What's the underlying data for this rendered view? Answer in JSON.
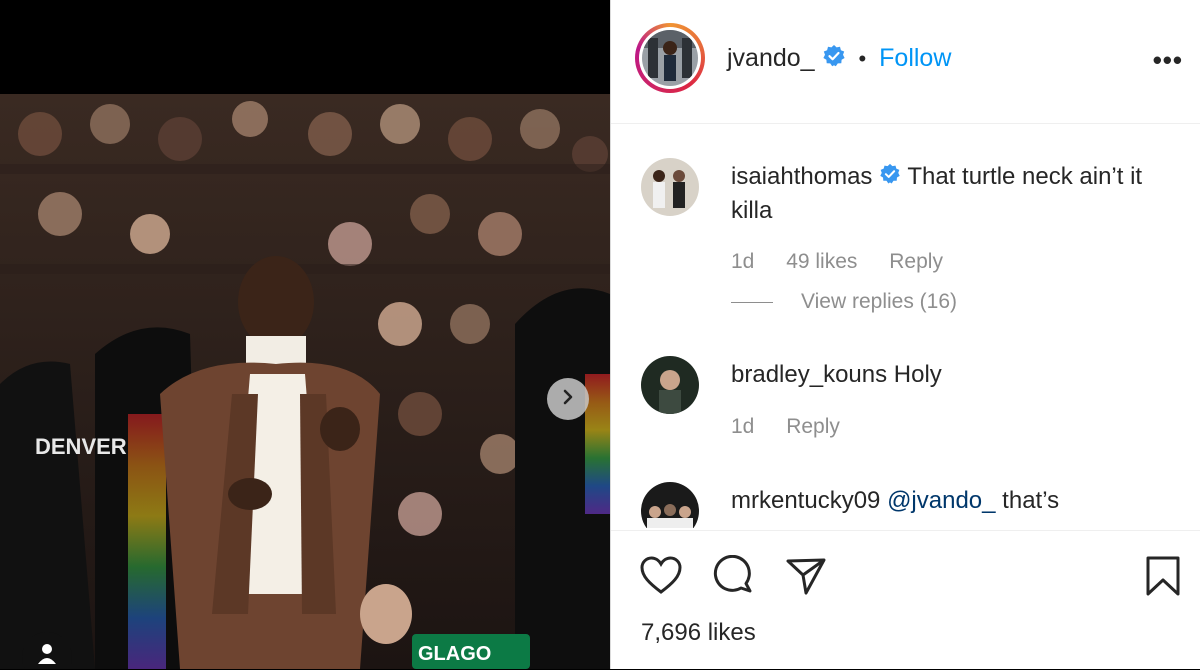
{
  "post": {
    "username": "jvando_",
    "separator": "•",
    "follow_label": "Follow",
    "more_label": "•••",
    "likes_text": "7,696 likes"
  },
  "comments": [
    {
      "username": "isaiahthomas",
      "verified": true,
      "text": "That turtle neck ain’t it killa",
      "time": "1d",
      "likes": "49 likes",
      "reply_label": "Reply",
      "view_replies": "View replies (16)"
    },
    {
      "username": "bradley_kouns",
      "verified": false,
      "text": "Holy",
      "time": "1d",
      "reply_label": "Reply"
    },
    {
      "username": "mrkentucky09",
      "verified": false,
      "mention": "@jvando_",
      "text": "that’s"
    }
  ],
  "media": {
    "jersey_text": "DENVER",
    "banner_text": "GLAGO"
  },
  "icons": {
    "heart": "heart-icon",
    "comment": "comment-icon",
    "share": "share-icon",
    "save": "bookmark-icon",
    "next": "chevron-right-icon",
    "tag": "user-tag-icon"
  },
  "colors": {
    "accent": "#0095f6",
    "verified": "#3897f0",
    "meta": "#8e8e8e"
  }
}
